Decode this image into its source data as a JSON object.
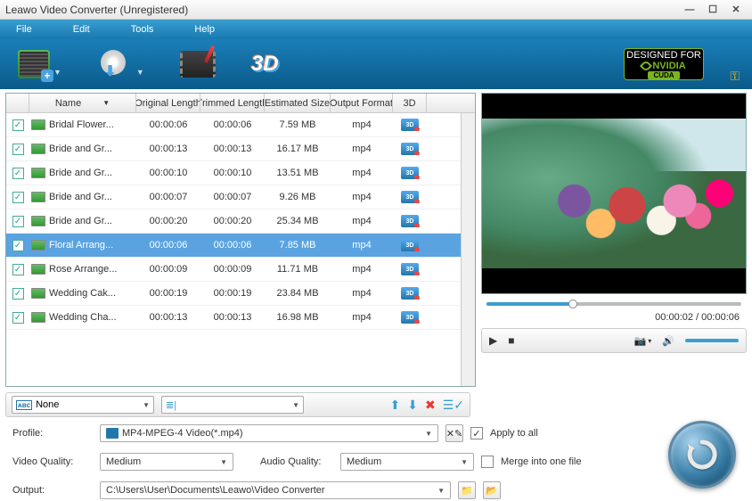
{
  "window": {
    "title": "Leawo Video Converter (Unregistered)"
  },
  "menubar": [
    "File",
    "Edit",
    "Tools",
    "Help"
  ],
  "toolbar": {
    "nvidia": {
      "designed": "DESIGNED FOR",
      "brand": "NVIDIA",
      "cuda": "CUDA"
    }
  },
  "columns": {
    "name": "Name",
    "original": "Original Length",
    "trimmed": "Trimmed Length",
    "estimated": "Estimated Size",
    "format": "Output Format",
    "td": "3D"
  },
  "rows": [
    {
      "checked": true,
      "name": "Bridal Flower...",
      "original": "00:00:06",
      "trimmed": "00:00:06",
      "size": "7.59 MB",
      "fmt": "mp4",
      "selected": false
    },
    {
      "checked": true,
      "name": "Bride and Gr...",
      "original": "00:00:13",
      "trimmed": "00:00:13",
      "size": "16.17 MB",
      "fmt": "mp4",
      "selected": false
    },
    {
      "checked": true,
      "name": "Bride and Gr...",
      "original": "00:00:10",
      "trimmed": "00:00:10",
      "size": "13.51 MB",
      "fmt": "mp4",
      "selected": false
    },
    {
      "checked": true,
      "name": "Bride and Gr...",
      "original": "00:00:07",
      "trimmed": "00:00:07",
      "size": "9.26 MB",
      "fmt": "mp4",
      "selected": false
    },
    {
      "checked": true,
      "name": "Bride and Gr...",
      "original": "00:00:20",
      "trimmed": "00:00:20",
      "size": "25.34 MB",
      "fmt": "mp4",
      "selected": false
    },
    {
      "checked": true,
      "name": "Floral Arrang...",
      "original": "00:00:06",
      "trimmed": "00:00:06",
      "size": "7.85 MB",
      "fmt": "mp4",
      "selected": true
    },
    {
      "checked": true,
      "name": "Rose Arrange...",
      "original": "00:00:09",
      "trimmed": "00:00:09",
      "size": "11.71 MB",
      "fmt": "mp4",
      "selected": false
    },
    {
      "checked": true,
      "name": "Wedding Cak...",
      "original": "00:00:19",
      "trimmed": "00:00:19",
      "size": "23.84 MB",
      "fmt": "mp4",
      "selected": false
    },
    {
      "checked": true,
      "name": "Wedding Cha...",
      "original": "00:00:13",
      "trimmed": "00:00:13",
      "size": "16.98 MB",
      "fmt": "mp4",
      "selected": false
    }
  ],
  "rename": {
    "label": "None"
  },
  "preview": {
    "current": "00:00:02",
    "total": "00:00:06",
    "time_sep": " / ",
    "progress_pct": 34
  },
  "settings": {
    "profile_label": "Profile:",
    "profile_value": "MP4-MPEG-4 Video(*.mp4)",
    "apply_all": "Apply to all",
    "apply_all_checked": true,
    "vq_label": "Video Quality:",
    "vq_value": "Medium",
    "aq_label": "Audio Quality:",
    "aq_value": "Medium",
    "merge": "Merge into one file",
    "merge_checked": false,
    "output_label": "Output:",
    "output_value": "C:\\Users\\User\\Documents\\Leawo\\Video Converter"
  },
  "icons": {
    "td": "3D"
  }
}
